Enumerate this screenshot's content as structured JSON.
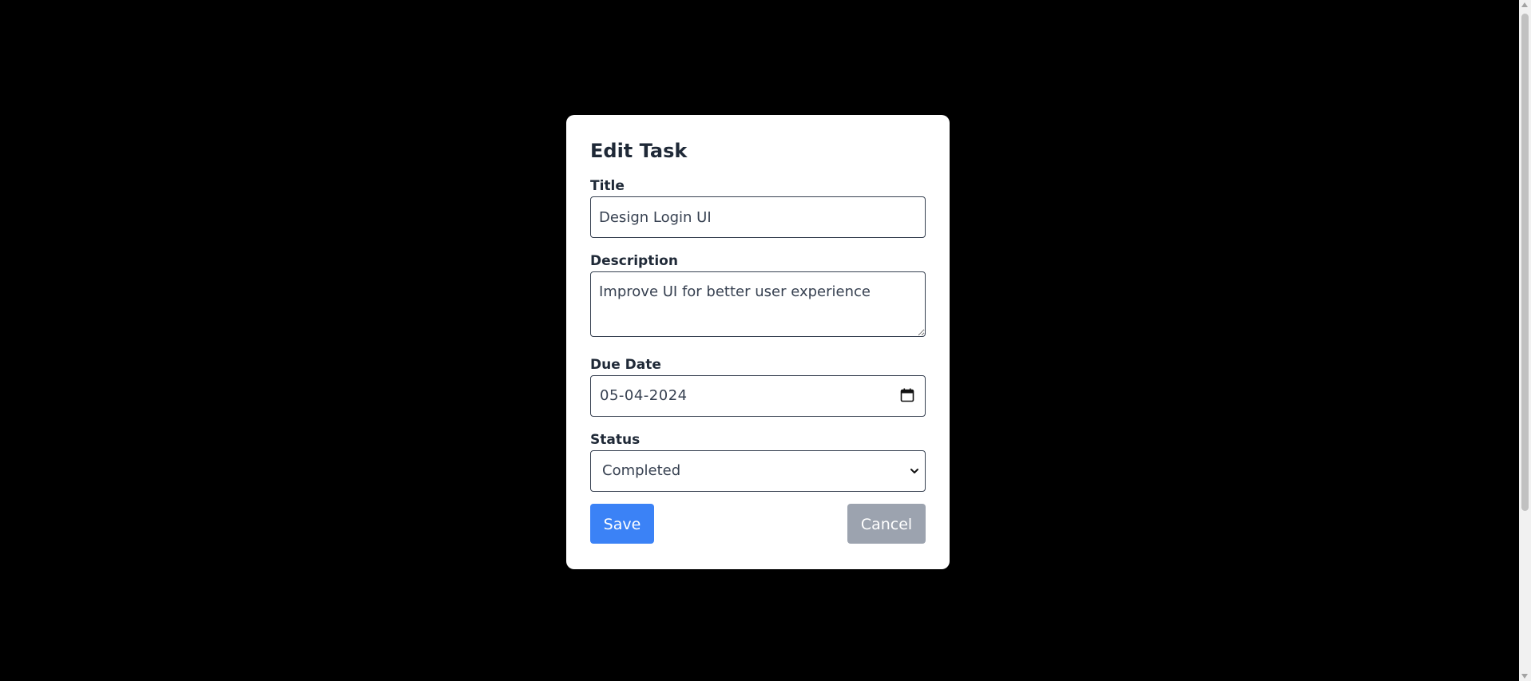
{
  "modal": {
    "title": "Edit Task",
    "fields": {
      "title": {
        "label": "Title",
        "value": "Design Login UI"
      },
      "description": {
        "label": "Description",
        "value": "Improve UI for better user experience"
      },
      "due_date": {
        "label": "Due Date",
        "value": "05-04-2024",
        "icon": "calendar-icon"
      },
      "status": {
        "label": "Status",
        "selected": "Completed",
        "icon": "chevron-down-icon"
      }
    },
    "actions": {
      "save_label": "Save",
      "cancel_label": "Cancel"
    }
  },
  "colors": {
    "backdrop": "#000000",
    "modal_background": "#ffffff",
    "text_dark": "#1f2937",
    "save_button": "#3b82f6",
    "cancel_button": "#9ca3af"
  }
}
